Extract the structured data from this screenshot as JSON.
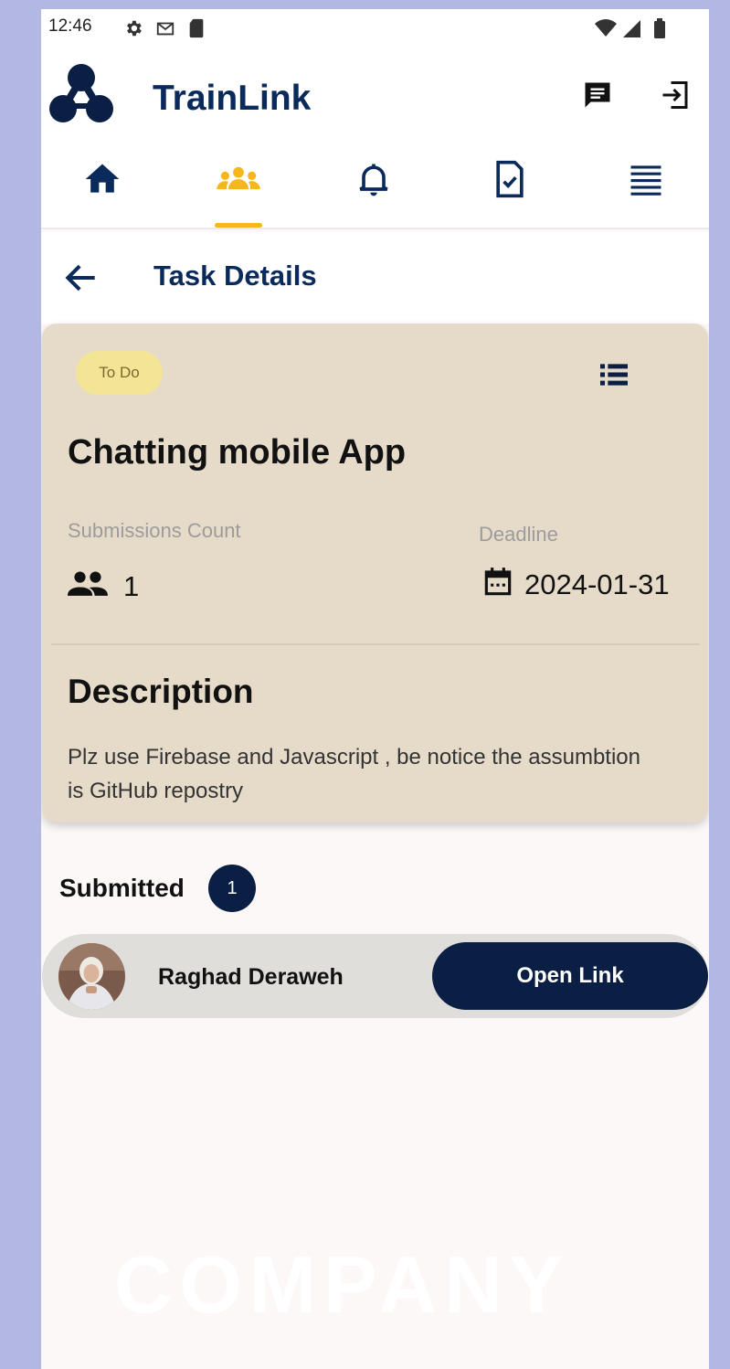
{
  "status_bar": {
    "time": "12:46",
    "icons": [
      "settings-icon",
      "gmail-icon",
      "sim-card-icon",
      "wifi-icon",
      "signal-icon",
      "battery-icon"
    ]
  },
  "app_bar": {
    "title": "TrainLink",
    "actions": [
      "chat-icon",
      "logout-icon"
    ]
  },
  "nav": {
    "items": [
      "home-icon",
      "groups-icon",
      "notifications-icon",
      "task-icon",
      "list-icon"
    ],
    "active_index": 1,
    "active_color": "#f7b718"
  },
  "page": {
    "title": "Task Details"
  },
  "task": {
    "status": "To Do",
    "title": "Chatting mobile App",
    "submissions_label": "Submissions Count",
    "submissions_count": "1",
    "deadline_label": "Deadline",
    "deadline": "2024-01-31",
    "description_heading": "Description",
    "description": "Plz use Firebase and Javascript , be notice the assumbtion is GitHub repostry"
  },
  "submitted": {
    "label": "Submitted",
    "count": "1",
    "items": [
      {
        "name": "Raghad Deraweh",
        "action_label": "Open Link"
      }
    ]
  },
  "watermark": "COMPANY",
  "colors": {
    "brand": "#0a2a5c",
    "accent": "#f7b718",
    "card": "#e6dbc9",
    "dark_button": "#0b1f45"
  }
}
